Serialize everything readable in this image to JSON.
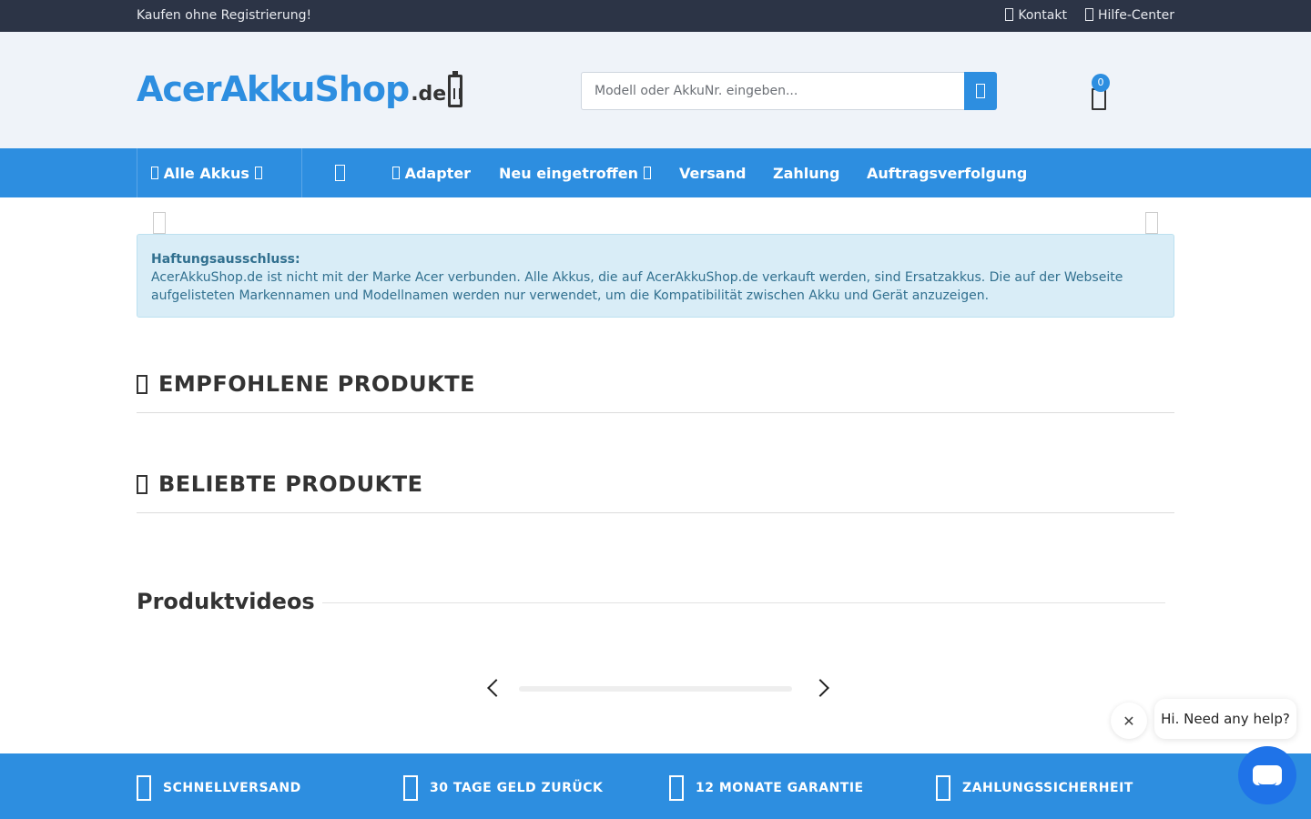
{
  "topbar": {
    "left_text": "Kaufen ohne Registrierung!",
    "contact_label": "Kontakt",
    "help_label": "Hilfe-Center"
  },
  "header": {
    "logo_brand": "AcerAkkuShop",
    "logo_tld": ".de",
    "search_placeholder": "Modell oder AkkuNr. eingeben...",
    "cart_count": "0"
  },
  "nav": {
    "all_batteries": "Alle Akkus",
    "adapter": "Adapter",
    "new_arrivals": "Neu eingetroffen",
    "shipping": "Versand",
    "payment": "Zahlung",
    "order_tracking": "Auftragsverfolgung"
  },
  "disclaimer": {
    "title": "Haftungsausschluss:",
    "text": "AcerAkkuShop.de ist nicht mit der Marke Acer verbunden. Alle Akkus, die auf AcerAkkuShop.de verkauft werden, sind Ersatzakkus. Die auf der Webseite aufgelisteten Markennamen und Modellnamen werden nur verwendet, um die Kompatibilität zwischen Akku und Gerät anzuzeigen."
  },
  "sections": {
    "recommended": "EMPFOHLENE PRODUKTE",
    "popular": "BELIEBTE PRODUKTE",
    "videos": "Produktvideos"
  },
  "benefits": [
    {
      "label": "SCHNELLVERSAND"
    },
    {
      "label": "30 TAGE GELD ZURÜCK"
    },
    {
      "label": "12 MONATE GARANTIE"
    },
    {
      "label": "ZAHLUNGSSICHERHEIT"
    }
  ],
  "chat": {
    "greeting": "Hi. Need any help?",
    "close_symbol": "✕"
  },
  "colors": {
    "accent": "#2d8ee0",
    "topbar": "#2c3446",
    "header_bg": "#eff3f9",
    "alert_bg": "#d9edf7",
    "alert_text": "#31708f",
    "chat_button": "#1f73e8"
  }
}
